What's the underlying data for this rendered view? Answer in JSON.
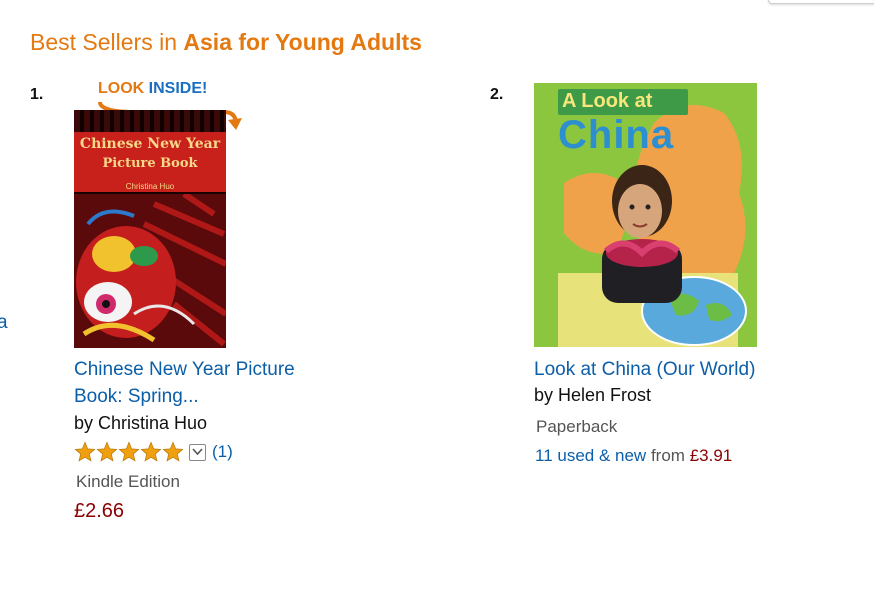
{
  "page": {
    "heading_prefix": "Best Sellers in",
    "heading_category": "Asia for Young Adults",
    "edge_text": "a"
  },
  "items": [
    {
      "rank": "1.",
      "look_inside_look": "LOOK",
      "look_inside_inside": "INSIDE!",
      "cover_title_line1": "Chinese New Year",
      "cover_title_line2": "Picture Book",
      "cover_author": "Christina Huo",
      "title_line1": "Chinese New Year Picture",
      "title_line2": "Book: Spring...",
      "author": "by Christina Huo",
      "rating": 5,
      "review_count": "(1)",
      "format": "Kindle Edition",
      "price": "£2.66"
    },
    {
      "rank": "2.",
      "cover_subtitle": "A Look at",
      "cover_title": "China",
      "title": "Look at China (Our World)",
      "author": "by Helen Frost",
      "format": "Paperback",
      "offers_link": "11 used & new",
      "offers_from": "from",
      "offers_price": "£3.91"
    }
  ],
  "colors": {
    "heading": "#e47911",
    "link": "#0b5ea8",
    "price": "#8b0000",
    "star": "#f0a00f"
  }
}
